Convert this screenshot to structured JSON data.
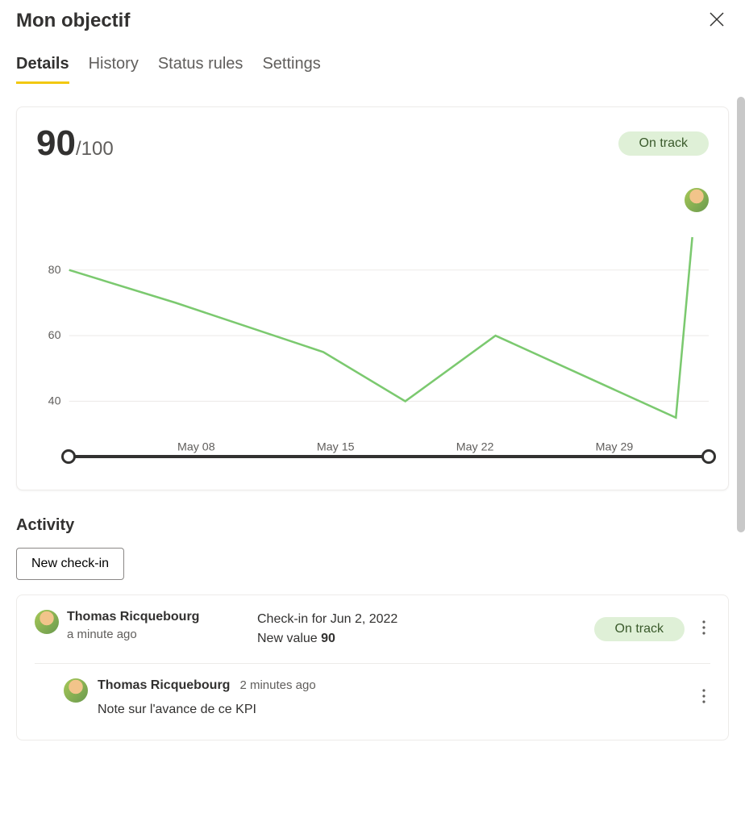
{
  "header": {
    "title": "Mon objectif"
  },
  "tabs": [
    {
      "label": "Details",
      "active": true
    },
    {
      "label": "History",
      "active": false
    },
    {
      "label": "Status rules",
      "active": false
    },
    {
      "label": "Settings",
      "active": false
    }
  ],
  "metric": {
    "value": "90",
    "target_suffix": "/100",
    "status": "On track"
  },
  "chart_data": {
    "type": "line",
    "x_ticks_visible": [
      "May 08",
      "May 15",
      "May 22",
      "May 29"
    ],
    "y_ticks": [
      40,
      60,
      80
    ],
    "ylim": [
      30,
      100
    ],
    "series": [
      {
        "name": "value",
        "color": "#7bc96f",
        "x": [
          "May 03",
          "May 08",
          "May 15",
          "May 19",
          "May 25",
          "Jun 01",
          "Jun 02"
        ],
        "y": [
          80,
          70,
          55,
          40,
          60,
          35,
          90
        ]
      }
    ]
  },
  "activity": {
    "section_title": "Activity",
    "new_checkin_label": "New check-in",
    "entries": [
      {
        "user": "Thomas Ricquebourg",
        "time": "a minute ago",
        "detail_line1": "Check-in for Jun 2, 2022",
        "detail_line2_prefix": "New value ",
        "detail_line2_value": "90",
        "status": "On track"
      }
    ],
    "comments": [
      {
        "user": "Thomas Ricquebourg",
        "time": "2 minutes ago",
        "text": "Note sur l'avance de ce KPI"
      }
    ]
  }
}
